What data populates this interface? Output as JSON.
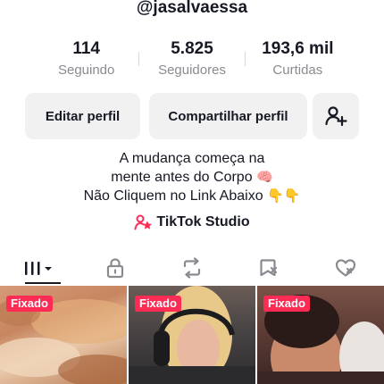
{
  "profile": {
    "handle": "@jasalvaessa"
  },
  "stats": [
    {
      "value": "114",
      "label": "Seguindo"
    },
    {
      "value": "5.825",
      "label": "Seguidores"
    },
    {
      "value": "193,6 mil",
      "label": "Curtidas"
    }
  ],
  "actions": {
    "edit_label": "Editar perfil",
    "share_label": "Compartilhar perfil",
    "add_friend_icon": "add-user-icon"
  },
  "bio": {
    "line1": "A mudança começa na",
    "line2": "mente antes do Corpo",
    "line2_emoji": "🧠",
    "line3": "Não Cliquem no Link Abaixo",
    "line3_emoji": "👇👇"
  },
  "studio": {
    "label": "TikTok Studio",
    "icon": "studio-icon",
    "icon_color": "#fe2c55"
  },
  "tabs": [
    {
      "icon": "grid-icon",
      "active": true
    },
    {
      "icon": "lock-icon",
      "active": false
    },
    {
      "icon": "repost-icon",
      "active": false
    },
    {
      "icon": "bookmark-icon",
      "active": false
    },
    {
      "icon": "liked-icon",
      "active": false
    }
  ],
  "videos": [
    {
      "badge": "Fixado"
    },
    {
      "badge": "Fixado"
    },
    {
      "badge": "Fixado"
    }
  ],
  "colors": {
    "accent": "#fe2c55",
    "text": "#161823",
    "muted": "#8a8b91",
    "button_bg": "#f1f1f2"
  }
}
